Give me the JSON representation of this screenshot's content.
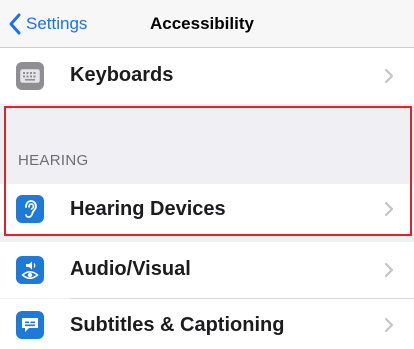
{
  "navbar": {
    "back_label": "Settings",
    "title": "Accessibility"
  },
  "rows": {
    "keyboards": {
      "label": "Keyboards",
      "icon": "keyboard-icon"
    },
    "hearing_devices": {
      "label": "Hearing Devices",
      "icon": "ear-icon"
    },
    "audio_visual": {
      "label": "Audio/Visual",
      "icon": "speaker-eye-icon"
    },
    "subtitles": {
      "label": "Subtitles & Captioning",
      "icon": "captions-icon"
    }
  },
  "sections": {
    "hearing": "HEARING"
  },
  "colors": {
    "accent": "#1a73e8",
    "keyboard_icon_bg": "#8e8e93",
    "hearing_icon_bg": "#1e7ad8",
    "highlight": "#e0232a"
  }
}
